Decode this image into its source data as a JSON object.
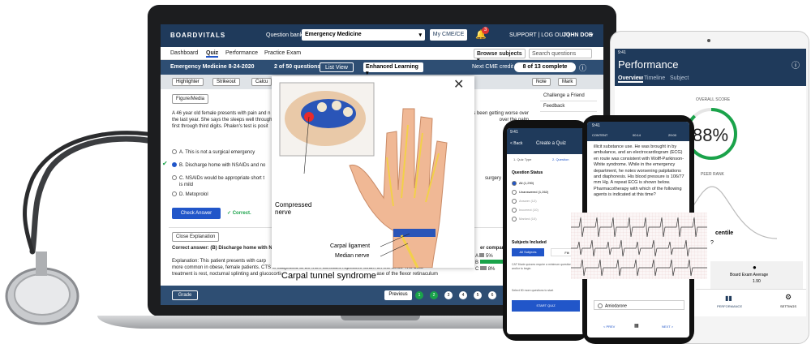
{
  "app": {
    "logo": "BOARDVITALS",
    "qbank_label": "Question bank:",
    "qbank_value": "Emergency Medicine",
    "cme_button": "My CME/CE",
    "links": "SUPPORT | LOG OUT |",
    "user": "JOHN DOE",
    "notif_count": "3"
  },
  "nav": {
    "items": [
      "Dashboard",
      "Quiz",
      "Performance",
      "Practice Exam"
    ],
    "browse": "Browse subjects",
    "search_placeholder": "Search questions"
  },
  "quizbar": {
    "title": "Emergency Medicine 8-24-2020",
    "progress": "2 of 50 questions",
    "list_view": "List View",
    "mode": "Enhanced Learning",
    "cme_label": "Next CME credit",
    "cme_progress": "8 of 13 complete"
  },
  "tools": {
    "highlighter": "Highlighter",
    "strikeout": "Strikeout",
    "calc": "Calcu",
    "note": "Note",
    "mark": "Mark"
  },
  "question": {
    "figure_button": "Figure/Media",
    "stem1": "A 46 year old female presents with pain and n",
    "stem1b": "has been getting worse over",
    "stem2": "the last year. She says the sleeps well through",
    "stem2b": "over the palm",
    "stem3": "first through third digits. Phalen's test is posit",
    "options": [
      {
        "text": "A. This is not a surgical emergency"
      },
      {
        "text": "B. Discharge home with NSAIDs and no"
      },
      {
        "text": "C. NSAIDs would be appropriate short t",
        "extra": "is mild",
        "tail": "surgery as her c"
      },
      {
        "text": "D. Metoprolol"
      }
    ],
    "check_button": "Check Answer",
    "correct": "Correct.",
    "close_explanation": "Close Explanation",
    "correct_answer": "Correct answer: (B) Discharge home with N",
    "comparison": "er comparison",
    "expl1": "Explanation: This patient presents with carp",
    "expl2": "more common in obese, female patients. CTS is subjected to be from constant repetitive strain on the wrist. The best",
    "expl3": "treatment is rest, nocturnal splinting and glucocorticoid injections. In severe cases, surgical release of the flexor retinaculum",
    "stats": [
      {
        "letter": "A",
        "pct": "5%"
      },
      {
        "letter": "B",
        "pct": ""
      },
      {
        "letter": "C",
        "pct": "8%"
      }
    ]
  },
  "side": {
    "items": [
      "Challenge a Friend",
      "Feedback"
    ]
  },
  "bottom": {
    "grade": "Grade",
    "previous": "Previous",
    "pages": [
      "1",
      "2",
      "3",
      "4",
      "5",
      "6"
    ]
  },
  "popup": {
    "compressed": "Compressed nerve",
    "ligament": "Carpal ligament",
    "median": "Median nerve",
    "title": "Carpal tunnel syndrome"
  },
  "tablet": {
    "time": "9:41",
    "title": "Performance",
    "tabs": [
      "Overview",
      "Timeline",
      "Subject"
    ],
    "overall": "OVERALL SCORE",
    "score": "88%",
    "peer": "PEER RANK",
    "centile": "centile",
    "board": "Board Exam Average",
    "board_val": "1.90",
    "nav_perf": "PERFORMANCE",
    "nav_settings": "SETTINGS",
    "percentile_value": 0.88
  },
  "phone1": {
    "time": "9:41",
    "title": "Create a Quiz",
    "tabs": [
      "1. Quiz Type",
      "2. Question"
    ],
    "status_label": "Question Status",
    "statuses": [
      "All (1,290)",
      "Unanswered (1,262)",
      "Answer (12)",
      "Incorrect (10)",
      "Marked (10)"
    ],
    "subjects_label": "Subjects Included",
    "all_subjects": "All Subjects",
    "filter": "Filt",
    "warning": "CAT Mode quizzes require a minimum questions and/or to begin.",
    "select_prompt": "Select 50 more questions to start",
    "start": "START QUIZ",
    "back": "< Back"
  },
  "phone2": {
    "time": "9:41",
    "header_left": "CONTENT",
    "header_mid": "00:14",
    "header_right": "29:00",
    "text": "illicit substance use. He was brought in by ambulance, and an electrocardiogram (ECG) en route was consistent with Wolff-Parkinson-White syndrome. While in the emergency department, he notes worsening palpitations and diaphoresis. His blood pressure is 106/77 mm Hg. A repeat ECG is shown below. Pharmacotherapy with which of the following agents is indicated at this time?",
    "option": "Amiodarone",
    "prev": "< PREV",
    "next": "NEXT >"
  },
  "colors": {
    "navy": "#1f3a5b",
    "blue": "#2156c9",
    "green": "#1aa34a"
  }
}
